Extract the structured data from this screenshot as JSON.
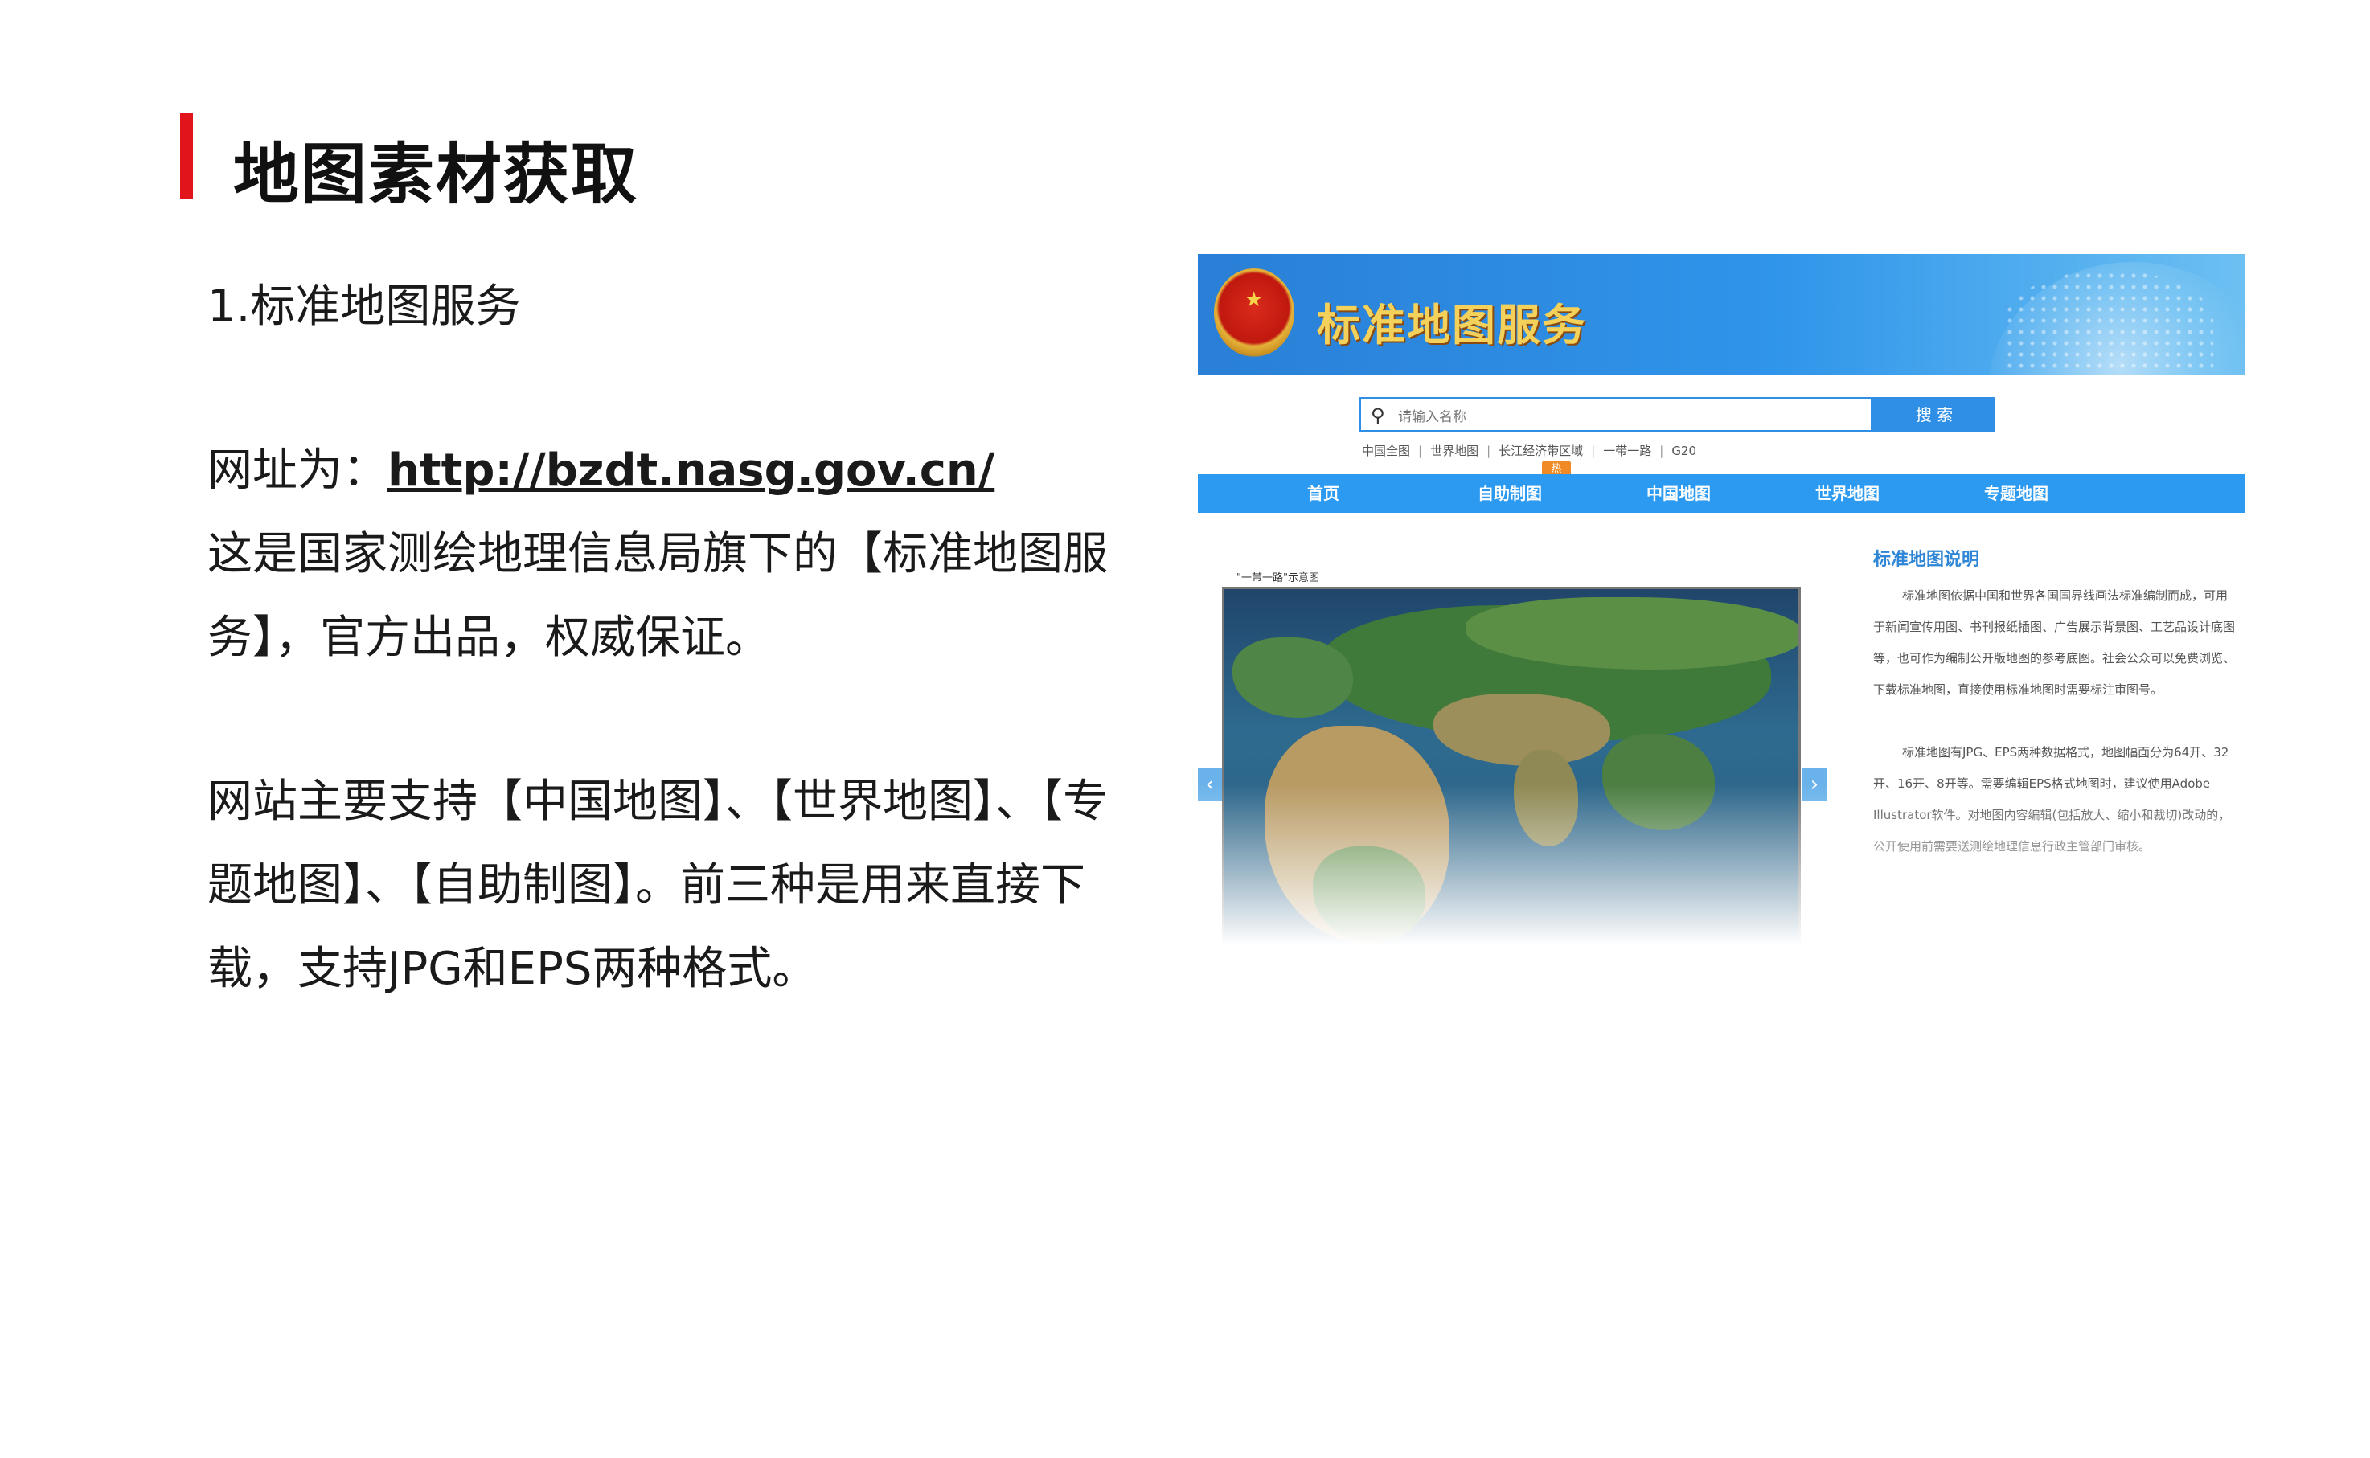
{
  "slide": {
    "title": "地图素材获取",
    "section": "1.标准地图服务",
    "url_label": "网址为：",
    "url": "http://bzdt.nasg.gov.cn/",
    "intro": "这是国家测绘地理信息局旗下的【标准地图服务】，官方出品，权威保证。",
    "support": "网站主要支持【中国地图】、【世界地图】、【专题地图】、【自助制图】。前三种是用来直接下载，支持JPG和EPS两种格式。"
  },
  "website": {
    "site_title": "标准地图服务",
    "search_placeholder": "请输入名称",
    "search_button": "搜 索",
    "quick_links": [
      "中国全图",
      "世界地图",
      "长江经济带区域",
      "一带一路",
      "G20"
    ],
    "hot_badge": "热",
    "nav": [
      "首页",
      "自助制图",
      "中国地图",
      "世界地图",
      "专题地图"
    ],
    "map_caption": "\"一带一路\"示意图",
    "prev_arrow": "‹",
    "next_arrow": "›",
    "desc_title": "标准地图说明",
    "desc_p1": "标准地图依据中国和世界各国国界线画法标准编制而成，可用于新闻宣传用图、书刊报纸插图、广告展示背景图、工艺品设计底图等，也可作为编制公开版地图的参考底图。社会公众可以免费浏览、下载标准地图，直接使用标准地图时需要标注审图号。",
    "desc_p2": "标准地图有JPG、EPS两种数据格式，地图幅面分为64开、32开、16开、8开等。需要编辑EPS格式地图时，建议使用Adobe Illustrator软件。对地图内容编辑(包括放大、缩小和裁切)改动的，公开使用前需要送测绘地理信息行政主管部门审核。",
    "colors": {
      "header_blue": "#2f95ea",
      "nav_blue": "#2b9af0",
      "title_gold": "#f4d15a",
      "accent_red": "#e2141b"
    }
  }
}
